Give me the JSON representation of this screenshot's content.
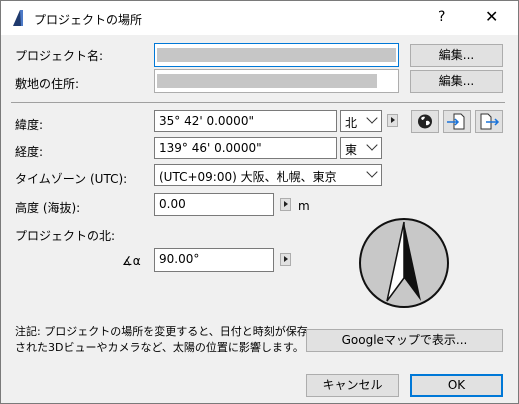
{
  "window": {
    "title": "プロジェクトの場所",
    "help_label": "?",
    "close_label": "✕"
  },
  "project": {
    "name_label": "プロジェクト名:",
    "site_label": "敷地の住所:",
    "edit_label": "編集..."
  },
  "geo": {
    "lat_label": "緯度:",
    "lat_value": "35° 42' 0.0000\"",
    "lat_dir": "北",
    "lon_label": "経度:",
    "lon_value": "139° 46' 0.0000\"",
    "lon_dir": "東",
    "tz_label": "タイムゾーン (UTC):",
    "tz_value": "(UTC+09:00) 大阪、札幌、東京",
    "alt_label": "高度 (海抜):",
    "alt_value": "0.00",
    "alt_unit": "m",
    "north_label": "プロジェクトの北:",
    "north_symbol": "∡α",
    "north_value": "90.00°"
  },
  "note": {
    "line1": "注記: プロジェクトの場所を変更すると、日付と時刻が保存",
    "line2": "された3Dビューやカメラなど、太陽の位置に影響します。"
  },
  "buttons": {
    "google": "Googleマップで表示...",
    "cancel": "キャンセル",
    "ok": "OK"
  },
  "icons": {
    "globe": "globe-icon",
    "import": "import-location-icon",
    "export": "export-location-icon",
    "compass": "north-compass-icon"
  }
}
